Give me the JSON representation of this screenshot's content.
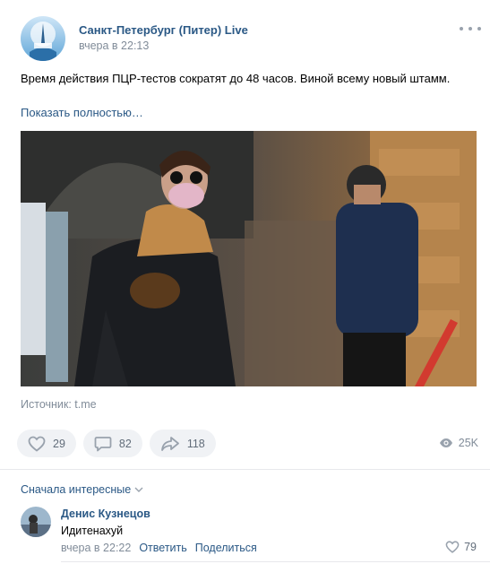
{
  "post": {
    "author": "Санкт-Петербург (Питер) Live",
    "time": "вчера в 22:13",
    "text": "Время действия ПЦР-тестов сократят до 48 часов. Виной всему новый штамм.",
    "show_more": "Показать полностью…",
    "source": "Источник: t.me"
  },
  "actions": {
    "likes": "29",
    "comments": "82",
    "shares": "118",
    "views": "25K",
    "icons": [
      "heart-icon",
      "comment-icon",
      "share-icon",
      "eye-icon"
    ]
  },
  "comments": {
    "sort_label": "Сначала интересные",
    "items": [
      {
        "author": "Денис Кузнецов",
        "text": "Идитенахуй",
        "time": "вчера в 22:22",
        "reply": "Ответить",
        "share": "Поделиться",
        "likes": "79"
      }
    ]
  },
  "colors": {
    "link": "#2a5885",
    "secondary": "#818c99",
    "pill_bg": "#f0f2f5",
    "icon": "#99a2ad"
  }
}
